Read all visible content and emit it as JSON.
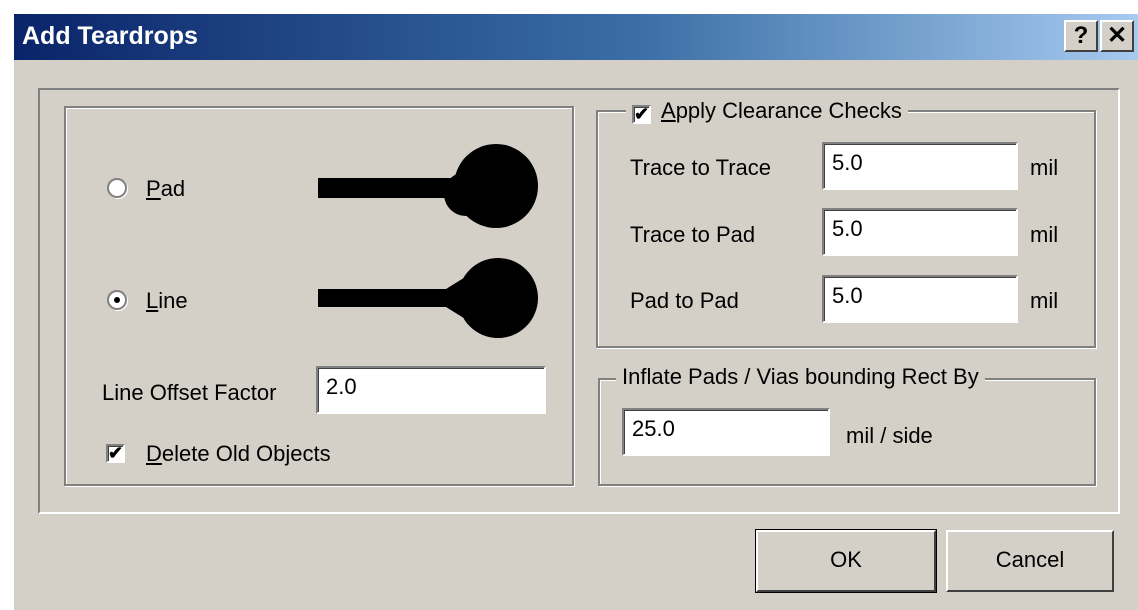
{
  "window": {
    "title": "Add Teardrops",
    "help_label": "?",
    "close_label": "✕"
  },
  "style_group": {
    "options": [
      {
        "label_mnemonic": "P",
        "label_rest": "ad",
        "selected": false
      },
      {
        "label_mnemonic": "L",
        "label_rest": "ine",
        "selected": true
      }
    ],
    "line_offset_factor": {
      "label": "Line Offset Factor",
      "value": "2.0"
    },
    "delete_old_objects": {
      "label_mnemonic": "D",
      "label_rest": "elete Old Objects",
      "checked": true
    }
  },
  "clearance_group": {
    "legend": {
      "check_mark": "✔",
      "label_mnemonic": "A",
      "label_rest": "pply Clearance Checks",
      "checked": true
    },
    "rows": [
      {
        "label": "Trace to Trace",
        "value": "5.0",
        "unit": "mil"
      },
      {
        "label": "Trace to Pad",
        "value": "5.0",
        "unit": "mil"
      },
      {
        "label": "Pad to Pad",
        "value": "5.0",
        "unit": "mil"
      }
    ]
  },
  "inflate_group": {
    "legend": "Inflate Pads / Vias bounding Rect By",
    "value": "25.0",
    "unit": "mil / side"
  },
  "buttons": {
    "ok": "OK",
    "cancel": "Cancel"
  },
  "check_glyph": "✔"
}
